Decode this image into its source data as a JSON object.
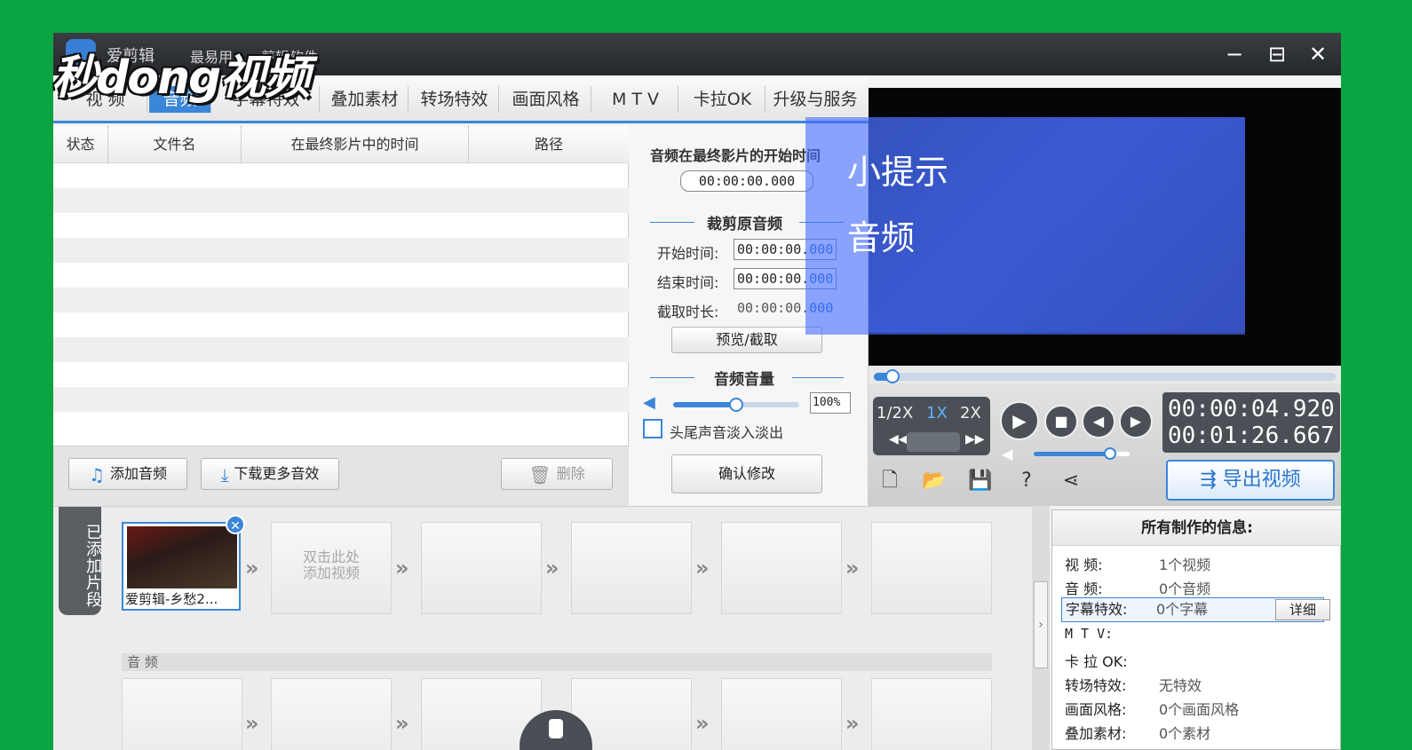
{
  "window": {
    "title": "爱剪辑",
    "slogan": "最易用、…剪辑软件",
    "controls": {
      "minimize": "−",
      "maximize": "⊟",
      "close": "✕"
    }
  },
  "watermark": "秒dong视频",
  "tabs": [
    {
      "label": "视 频"
    },
    {
      "label": "音频"
    },
    {
      "label": "字幕特效"
    },
    {
      "label": "叠加素材"
    },
    {
      "label": "转场特效"
    },
    {
      "label": "画面风格"
    },
    {
      "label": "M T V"
    },
    {
      "label": "卡拉OK"
    },
    {
      "label": "升级与服务"
    }
  ],
  "audio_list": {
    "columns": [
      "状态",
      "文件名",
      "在最终影片中的时间",
      "路径"
    ],
    "add_button": "添加音频",
    "download_button": "下载更多音效",
    "delete_button": "删除"
  },
  "audio_settings": {
    "start_in_movie_label": "音频在最终影片的开始时间",
    "start_in_movie_value": "00:00:00.000",
    "trim_title": "裁剪原音频",
    "start_time_label": "开始时间:",
    "start_time_value": "00:00:00.",
    "start_time_ms": "000",
    "end_time_label": "结束时间:",
    "end_time_value": "00:00:00.",
    "end_time_ms": "000",
    "duration_label": "截取时长:",
    "duration_value": "00:00:00.",
    "duration_ms": "000",
    "preview_button": "预览/截取",
    "volume_title": "音频音量",
    "volume_value": "100%",
    "volume_level": 0.5,
    "fade_label": "头尾声音淡入淡出",
    "fade_checked": false,
    "confirm_button": "确认修改"
  },
  "tip": {
    "title": "小提示",
    "body": "音频"
  },
  "player": {
    "progress": 0.04,
    "speeds": [
      "1/2X",
      "1X",
      "2X"
    ],
    "current_time": "00:00:04.920",
    "total_time": "00:01:26.667",
    "volume_level": 0.8,
    "export_button": "导出视频"
  },
  "timeline": {
    "side_tab": "已添加片段",
    "clip_label": "爱剪辑-乡愁2...",
    "empty_slot_text": "双击此处\n添加视频",
    "audio_track_label": "音 频"
  },
  "info": {
    "title": "所有制作的信息:",
    "rows": [
      {
        "label": "视    频:",
        "value": "1个视频"
      },
      {
        "label": "音    频:",
        "value": "0个音频"
      },
      {
        "label": "字幕特效:",
        "value": "0个字幕"
      },
      {
        "label": "M  T  V:",
        "value": ""
      },
      {
        "label": "卡 拉 OK:",
        "value": ""
      },
      {
        "label": "转场特效:",
        "value": "无特效"
      },
      {
        "label": "画面风格:",
        "value": "0个画面风格"
      },
      {
        "label": "叠加素材:",
        "value": "0个素材"
      }
    ],
    "detail_button": "详细"
  },
  "colors": {
    "accent": "#3b86d8",
    "background": "#0aa442",
    "tip_overlay": "#466eff"
  }
}
